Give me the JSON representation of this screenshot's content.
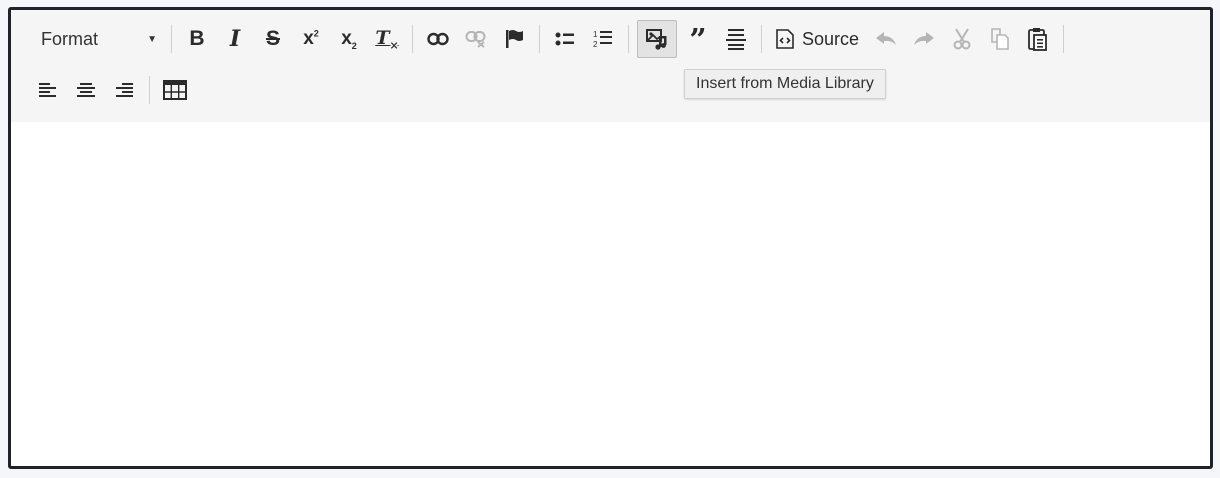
{
  "toolbar": {
    "format_label": "Format",
    "source_label": "Source",
    "tooltip": "Insert from Media Library",
    "buttons": [
      {
        "name": "bold",
        "label": "B"
      },
      {
        "name": "italic",
        "label": "I"
      },
      {
        "name": "strikethrough",
        "label": "S"
      },
      {
        "name": "superscript",
        "label": "x²"
      },
      {
        "name": "subscript",
        "label": "x₂"
      },
      {
        "name": "remove-format",
        "label": "Tx"
      }
    ]
  },
  "editor": {
    "content": ""
  }
}
